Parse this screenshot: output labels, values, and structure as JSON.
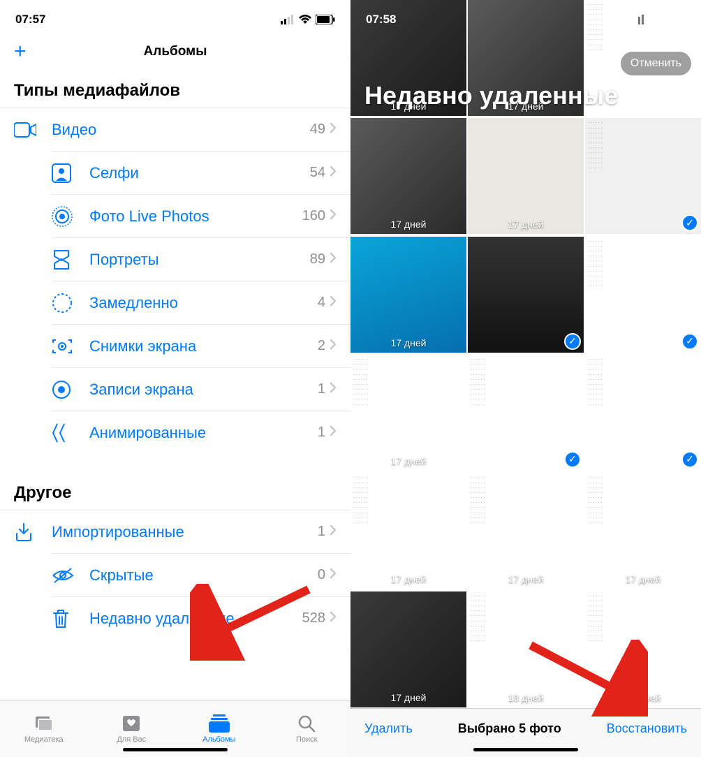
{
  "left": {
    "time": "07:57",
    "header_title": "Альбомы",
    "section_media": "Типы медиафайлов",
    "section_other": "Другое",
    "media_items": [
      {
        "icon": "video",
        "label": "Видео",
        "count": "49"
      },
      {
        "icon": "selfie",
        "label": "Селфи",
        "count": "54"
      },
      {
        "icon": "live",
        "label": "Фото Live Photos",
        "count": "160"
      },
      {
        "icon": "portrait",
        "label": "Портреты",
        "count": "89"
      },
      {
        "icon": "slomo",
        "label": "Замедленно",
        "count": "4"
      },
      {
        "icon": "screenshot",
        "label": "Снимки экрана",
        "count": "2"
      },
      {
        "icon": "record",
        "label": "Записи экрана",
        "count": "1"
      },
      {
        "icon": "animated",
        "label": "Анимированные",
        "count": "1"
      }
    ],
    "other_items": [
      {
        "icon": "import",
        "label": "Импортированные",
        "count": "1"
      },
      {
        "icon": "hidden",
        "label": "Скрытые",
        "count": "0"
      },
      {
        "icon": "trash",
        "label": "Недавно удаленные",
        "count": "528"
      }
    ],
    "tabs": [
      {
        "label": "Медиатека"
      },
      {
        "label": "Для Вас"
      },
      {
        "label": "Альбомы"
      },
      {
        "label": "Поиск"
      }
    ]
  },
  "right": {
    "time": "07:58",
    "title": "Недавно удаленные",
    "cancel": "Отменить",
    "toolbar": {
      "delete": "Удалить",
      "status": "Выбрано 5 фото",
      "restore": "Восстановить"
    },
    "thumbs": [
      {
        "days": "17 дней",
        "sel": false,
        "bg": "bg-dark1"
      },
      {
        "days": "17 дней",
        "sel": false,
        "bg": "bg-dark2"
      },
      {
        "days": "",
        "sel": false,
        "bg": "bg-white"
      },
      {
        "days": "17 дней",
        "sel": false,
        "bg": "bg-dark2"
      },
      {
        "days": "17 дней",
        "sel": false,
        "bg": "bg-paper"
      },
      {
        "days": "",
        "sel": true,
        "bg": "bg-light"
      },
      {
        "days": "17 дней",
        "sel": false,
        "bg": "bg-blue"
      },
      {
        "days": "",
        "sel": true,
        "bg": "bg-card"
      },
      {
        "days": "",
        "sel": true,
        "bg": "bg-white"
      },
      {
        "days": "17 дней",
        "sel": false,
        "bg": "bg-white"
      },
      {
        "days": "",
        "sel": true,
        "bg": "bg-white"
      },
      {
        "days": "",
        "sel": true,
        "bg": "bg-white"
      },
      {
        "days": "17 дней",
        "sel": false,
        "bg": "bg-white"
      },
      {
        "days": "17 дней",
        "sel": false,
        "bg": "bg-white"
      },
      {
        "days": "17 дней",
        "sel": false,
        "bg": "bg-white"
      },
      {
        "days": "17 дней",
        "sel": false,
        "bg": "bg-dark1"
      },
      {
        "days": "18 дней",
        "sel": false,
        "bg": "bg-white"
      },
      {
        "days": "18 дней",
        "sel": false,
        "bg": "bg-white"
      }
    ]
  }
}
